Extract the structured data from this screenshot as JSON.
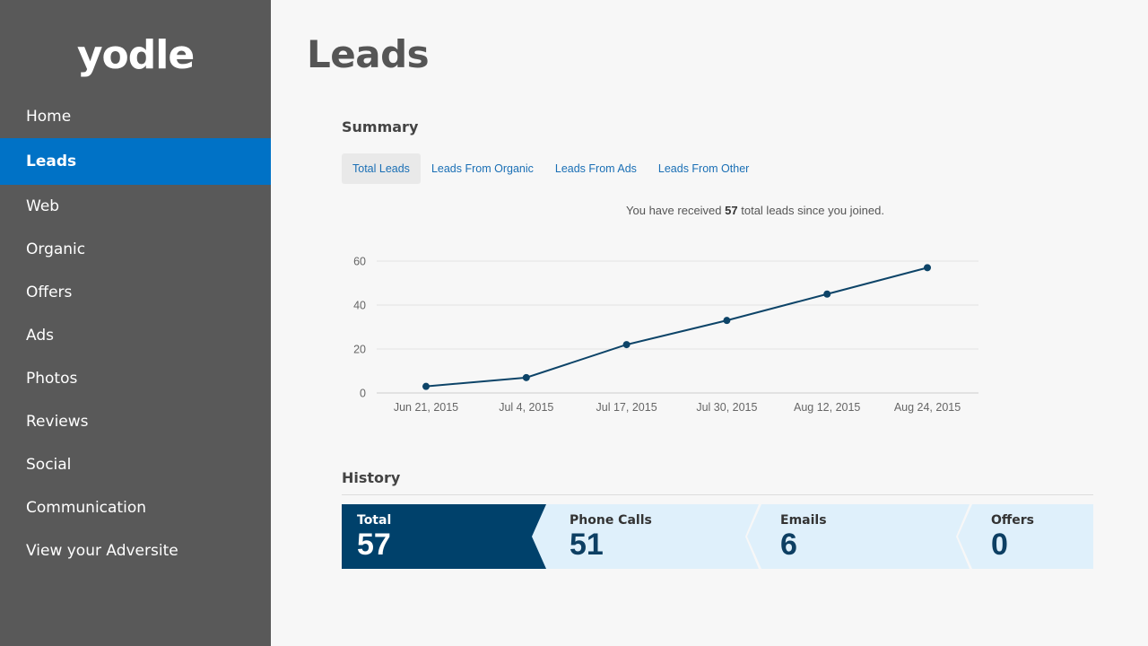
{
  "app": {
    "logo": "yodle"
  },
  "sidebar": {
    "items": [
      {
        "label": "Home",
        "active": false
      },
      {
        "label": "Leads",
        "active": true
      },
      {
        "label": "Web",
        "active": false
      },
      {
        "label": "Organic",
        "active": false
      },
      {
        "label": "Offers",
        "active": false
      },
      {
        "label": "Ads",
        "active": false
      },
      {
        "label": "Photos",
        "active": false
      },
      {
        "label": "Reviews",
        "active": false
      },
      {
        "label": "Social",
        "active": false
      },
      {
        "label": "Communication",
        "active": false
      },
      {
        "label": "View your Adversite",
        "active": false
      }
    ]
  },
  "main": {
    "title": "Leads",
    "summary": {
      "heading": "Summary",
      "tabs": [
        {
          "label": "Total Leads",
          "active": true
        },
        {
          "label": "Leads From Organic",
          "active": false
        },
        {
          "label": "Leads From Ads",
          "active": false
        },
        {
          "label": "Leads From Other",
          "active": false
        }
      ],
      "message_prefix": "You have received",
      "message_count": "57",
      "message_suffix": "total leads since you joined."
    },
    "history": {
      "heading": "History",
      "segments": [
        {
          "label": "Total",
          "value": "57"
        },
        {
          "label": "Phone Calls",
          "value": "51"
        },
        {
          "label": "Emails",
          "value": "6"
        },
        {
          "label": "Offers",
          "value": "0"
        }
      ]
    }
  },
  "colors": {
    "sidebar_bg": "#595959",
    "active_nav": "#0072c6",
    "chart_line": "#0d4468",
    "history_total_bg": "#00416b",
    "history_segment_bg": "#dff0fb",
    "history_value_text": "#0d3f63",
    "link": "#1a6fb5"
  },
  "chart_data": {
    "type": "line",
    "x": [
      "Jun 21, 2015",
      "Jul 4, 2015",
      "Jul 17, 2015",
      "Jul 30, 2015",
      "Aug 12, 2015",
      "Aug 24, 2015"
    ],
    "series": [
      {
        "values": [
          3,
          7,
          22,
          33,
          45,
          57
        ]
      }
    ],
    "yticks": [
      0,
      20,
      40,
      60
    ],
    "ylim": [
      0,
      60
    ],
    "grid": true
  }
}
